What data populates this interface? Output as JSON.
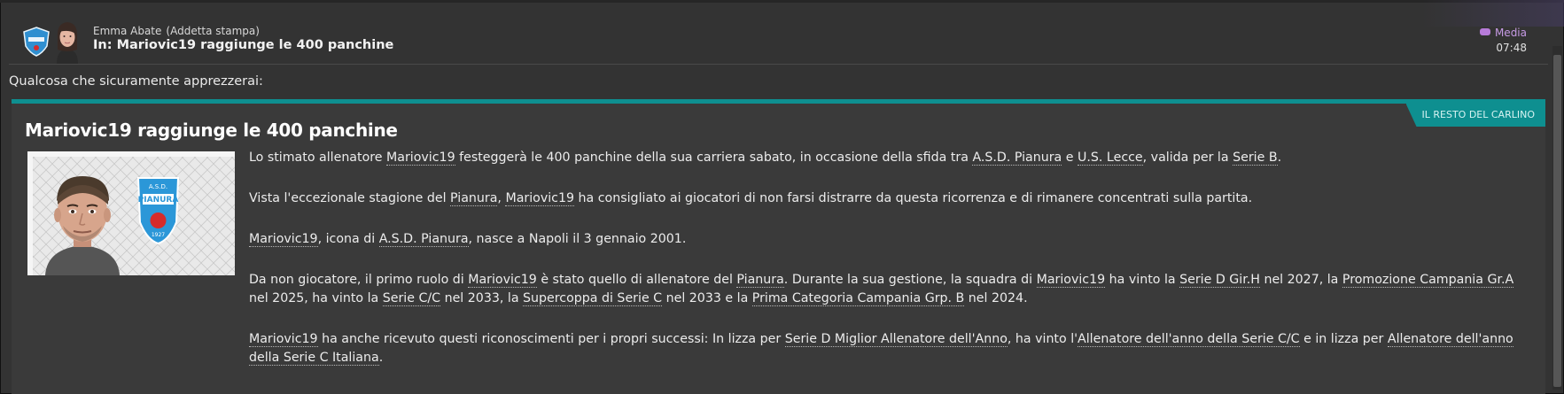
{
  "header": {
    "sender_name": "Emma Abate",
    "sender_role": "(Addetta stampa)",
    "subject": "In: Mariovic19 raggiunge le 400 panchine",
    "priority_label": "Media",
    "time": "07:48"
  },
  "intro": "Qualcosa che sicuramente apprezzerai:",
  "article": {
    "source": "IL RESTO DEL CARLINO",
    "headline": "Mariovic19 raggiunge le 400 panchine",
    "crest_text_top": "A.S.D.",
    "crest_text_name": "PIANURA",
    "crest_year": "1927",
    "p1": {
      "a": "Lo stimato allenatore ",
      "l1": "Mariovic19",
      "b": " festeggerà le 400 panchine della sua carriera sabato, in occasione della sfida tra ",
      "l2": "A.S.D. Pianura",
      "c": " e ",
      "l3": "U.S. Lecce",
      "d": ", valida per la ",
      "l4": "Serie B",
      "e": "."
    },
    "p2": {
      "a": "Vista l'eccezionale stagione del ",
      "l1": "Pianura",
      "b": ", ",
      "l2": "Mariovic19",
      "c": " ha consigliato ai giocatori di non farsi distrarre da questa ricorrenza e di rimanere concentrati sulla partita."
    },
    "p3": {
      "l1": "Mariovic19",
      "a": ", icona di ",
      "l2": "A.S.D. Pianura",
      "b": ", nasce a Napoli il 3 gennaio 2001."
    },
    "p4": {
      "a": "Da non giocatore, il primo ruolo di ",
      "l1": "Mariovic19",
      "b": " è stato quello di allenatore del ",
      "l2": "Pianura",
      "c": ". Durante la sua gestione, la squadra di ",
      "l3": "Mariovic19",
      "d": " ha vinto la ",
      "l4": "Serie D Gir.H",
      "e": " nel 2027, la ",
      "l5": "Promozione Campania Gr.A",
      "f": " nel 2025, ha vinto la ",
      "l6": "Serie C/C",
      "g": " nel 2033, la ",
      "l7": "Supercoppa di Serie C",
      "h": " nel 2033 e la ",
      "l8": "Prima Categoria Campania Grp. B",
      "i": " nel 2024."
    },
    "p5": {
      "l1": "Mariovic19",
      "a": " ha anche ricevuto questi riconoscimenti per i propri successi: In lizza per ",
      "l2": "Serie D Miglior Allenatore dell'Anno",
      "b": ", ha vinto l'",
      "l3": "Allenatore dell'anno della Serie C/C",
      "c": " e in lizza per ",
      "l4": "Allenatore dell'anno della Serie C Italiana",
      "d": "."
    }
  },
  "icons": {
    "club_badge": "club-crest-icon",
    "avatar": "press-officer-avatar",
    "priority": "tag-icon"
  },
  "colors": {
    "accent": "#0e8f90",
    "priority": "#c79be6",
    "background": "#333333"
  }
}
